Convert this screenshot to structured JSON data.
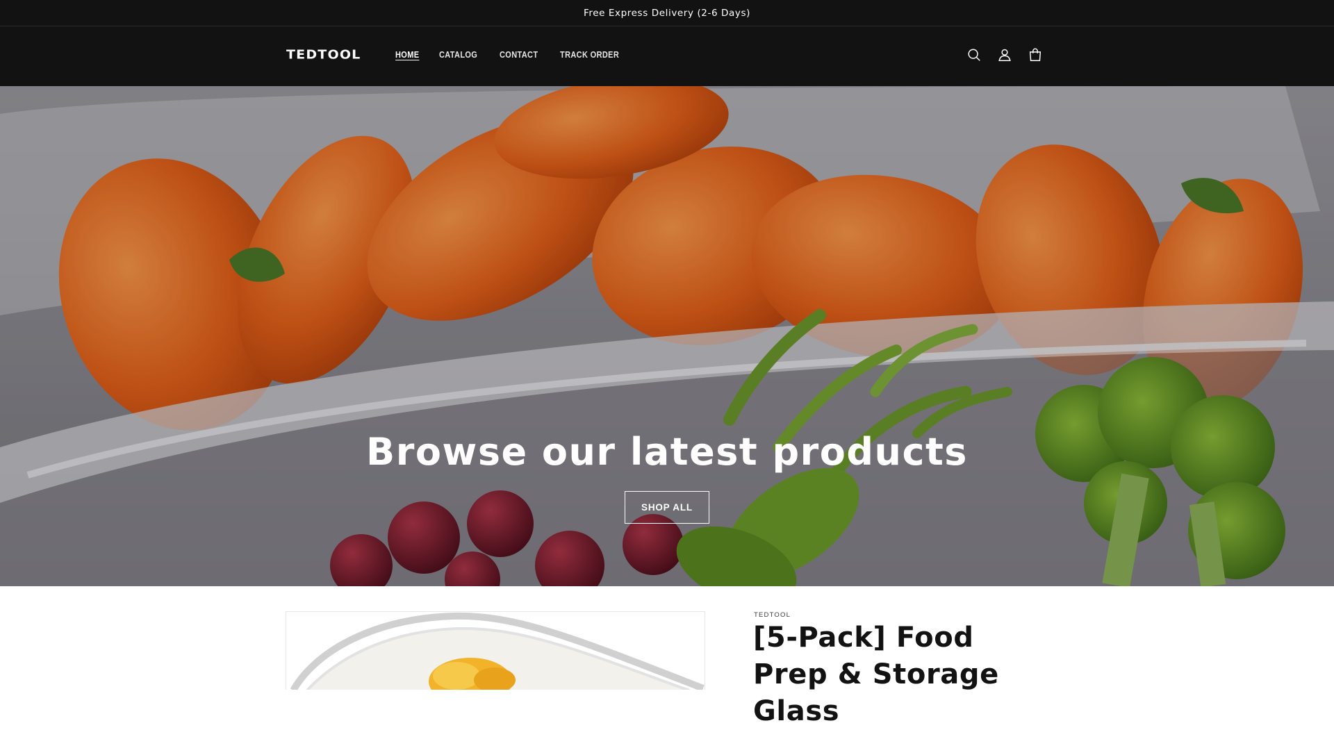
{
  "announcement": {
    "text": "Free Express Delivery (2-6 Days)"
  },
  "header": {
    "logo": "TEDTOOL",
    "nav": [
      {
        "label": "HOME",
        "active": true
      },
      {
        "label": "CATALOG",
        "active": false
      },
      {
        "label": "CONTACT",
        "active": false
      },
      {
        "label": "TRACK ORDER",
        "active": false
      }
    ],
    "icons": [
      "search-icon",
      "account-icon",
      "cart-icon"
    ]
  },
  "hero": {
    "title": "Browse our latest products",
    "button_label": "SHOP ALL"
  },
  "product": {
    "vendor": "TEDTOOL",
    "title": "[5-Pack] Food Prep & Storage Glass"
  },
  "colors": {
    "header_bg": "#121212",
    "text_light": "#ffffff",
    "accent_orange": "#e8671c"
  }
}
